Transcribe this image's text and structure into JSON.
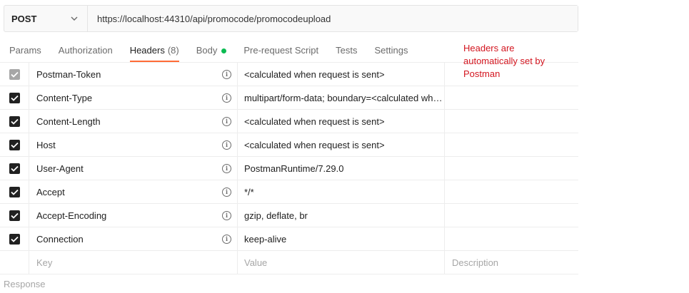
{
  "request": {
    "method": "POST",
    "url": "https://localhost:44310/api/promocode/promocodeupload"
  },
  "tabs": [
    {
      "label": "Params"
    },
    {
      "label": "Authorization"
    },
    {
      "label": "Headers",
      "count": "(8)"
    },
    {
      "label": "Body"
    },
    {
      "label": "Pre-request Script"
    },
    {
      "label": "Tests"
    },
    {
      "label": "Settings"
    }
  ],
  "annotation": "Headers are automatically set by Postman",
  "headers": [
    {
      "key": "Postman-Token",
      "value": "<calculated when request is sent>",
      "description": ""
    },
    {
      "key": "Content-Type",
      "value": "multipart/form-data; boundary=<calculated wh…",
      "description": ""
    },
    {
      "key": "Content-Length",
      "value": "<calculated when request is sent>",
      "description": ""
    },
    {
      "key": "Host",
      "value": "<calculated when request is sent>",
      "description": ""
    },
    {
      "key": "User-Agent",
      "value": "PostmanRuntime/7.29.0",
      "description": ""
    },
    {
      "key": "Accept",
      "value": "*/*",
      "description": ""
    },
    {
      "key": "Accept-Encoding",
      "value": "gzip, deflate, br",
      "description": ""
    },
    {
      "key": "Connection",
      "value": "keep-alive",
      "description": ""
    }
  ],
  "new_row": {
    "key_placeholder": "Key",
    "value_placeholder": "Value",
    "description_placeholder": "Description"
  },
  "response_label": "Response",
  "colors": {
    "active_tab_underline": "#ff6c37",
    "body_dot": "#0cbb52",
    "annotation": "#d3151f"
  }
}
